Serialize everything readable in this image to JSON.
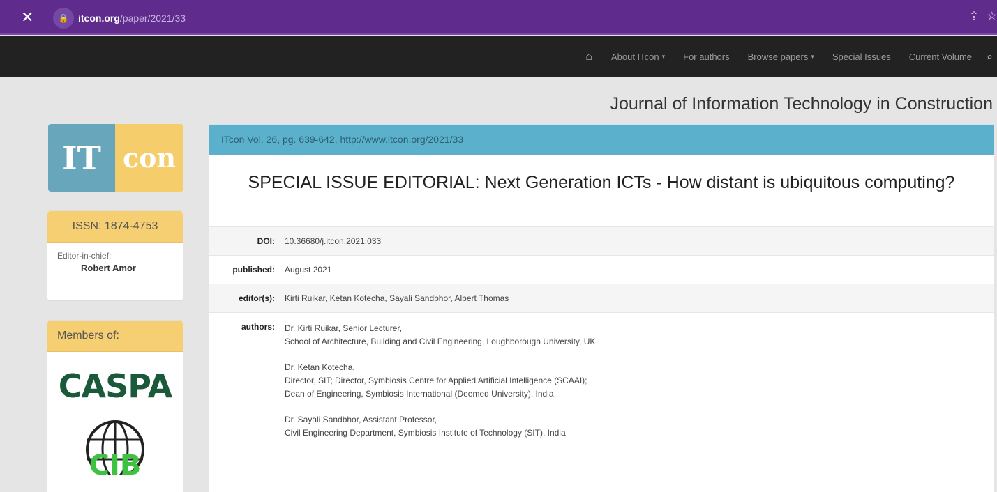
{
  "browser": {
    "close_icon": "close-icon",
    "url_host": "itcon.org",
    "url_path": "/paper/2021/33"
  },
  "navbar": {
    "home_icon": "home-icon",
    "items": [
      {
        "label": "About ITcon",
        "dropdown": true
      },
      {
        "label": "For authors",
        "dropdown": false
      },
      {
        "label": "Browse papers",
        "dropdown": true
      },
      {
        "label": "Special Issues",
        "dropdown": false
      },
      {
        "label": "Current Volume",
        "dropdown": false
      }
    ],
    "search_icon": "search-icon"
  },
  "journal_title": "Journal of Information Technology in Construction",
  "sidebar": {
    "logo": {
      "part1": "IT",
      "part2": "con"
    },
    "issn": "ISSN: 1874-4753",
    "editor_label": "Editor-in-chief:",
    "editor_name": "Robert Amor",
    "members_heading": "Members of:",
    "member_logos": [
      "CASPA",
      "CIB"
    ]
  },
  "paper": {
    "citation": "ITcon Vol. 26, pg. 639-642, http://www.itcon.org/2021/33",
    "title": "SPECIAL ISSUE EDITORIAL: Next Generation ICTs - How distant is ubiquitous computing?",
    "doi_label": "DOI:",
    "doi": "10.36680/j.itcon.2021.033",
    "published_label": "published:",
    "published": "August 2021",
    "editors_label": "editor(s):",
    "editors": "Kirti Ruikar, Ketan Kotecha, Sayali Sandbhor, Albert Thomas",
    "authors_label": "authors:",
    "authors": [
      {
        "line1": "Dr. Kirti Ruikar, Senior Lecturer,",
        "line2": "School of Architecture, Building and Civil Engineering, Loughborough University, UK",
        "line3": ""
      },
      {
        "line1": "Dr. Ketan Kotecha,",
        "line2": "Director, SIT; Director, Symbiosis Centre for Applied Artificial Intelligence (SCAAI);",
        "line3": "Dean of Engineering, Symbiosis International (Deemed University), India"
      },
      {
        "line1": "Dr. Sayali Sandbhor, Assistant Professor,",
        "line2": "Civil Engineering Department, Symbiosis Institute of Technology (SIT), India",
        "line3": ""
      }
    ]
  },
  "colors": {
    "browser_bar": "#5f2c8e",
    "navbar": "#222222",
    "accent_blue": "#5bb1cc",
    "accent_yellow": "#f7cf73",
    "logo_blue": "#67a6bb"
  }
}
